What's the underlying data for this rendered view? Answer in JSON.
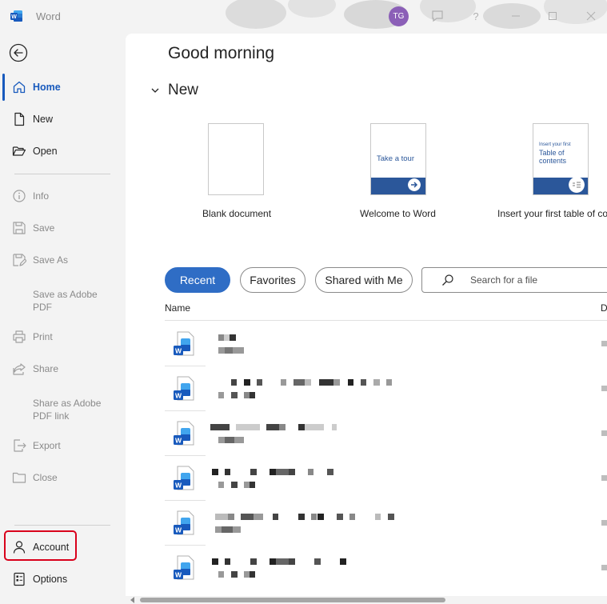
{
  "app": {
    "title": "Word",
    "user_initials": "TG"
  },
  "sidebar": {
    "items": [
      {
        "id": "home",
        "label": "Home"
      },
      {
        "id": "new",
        "label": "New"
      },
      {
        "id": "open",
        "label": "Open"
      },
      {
        "id": "info",
        "label": "Info"
      },
      {
        "id": "save",
        "label": "Save"
      },
      {
        "id": "save_as",
        "label": "Save As"
      },
      {
        "id": "save_adobe",
        "label": "Save as Adobe\nPDF"
      },
      {
        "id": "print",
        "label": "Print"
      },
      {
        "id": "share",
        "label": "Share"
      },
      {
        "id": "share_adobe",
        "label": "Share as Adobe\nPDF link"
      },
      {
        "id": "export",
        "label": "Export"
      },
      {
        "id": "close",
        "label": "Close"
      },
      {
        "id": "account",
        "label": "Account"
      },
      {
        "id": "options",
        "label": "Options"
      }
    ]
  },
  "main": {
    "greeting": "Good morning",
    "new_heading": "New",
    "templates": [
      {
        "label": "Blank document"
      },
      {
        "label": "Welcome to Word",
        "thumb_text": "Take a tour"
      },
      {
        "label": "Insert your first table of co",
        "thumb_line1": "Insert your first",
        "thumb_line2": "Table of",
        "thumb_line3": "contents"
      }
    ],
    "tabs": [
      "Recent",
      "Favorites",
      "Shared with Me"
    ],
    "search_placeholder": "Search for a file",
    "columns": {
      "name": "Name",
      "date": "D"
    }
  },
  "colors": {
    "accent": "#185abd",
    "highlight_border": "#d9001b",
    "word_blue": "#2b579a"
  }
}
